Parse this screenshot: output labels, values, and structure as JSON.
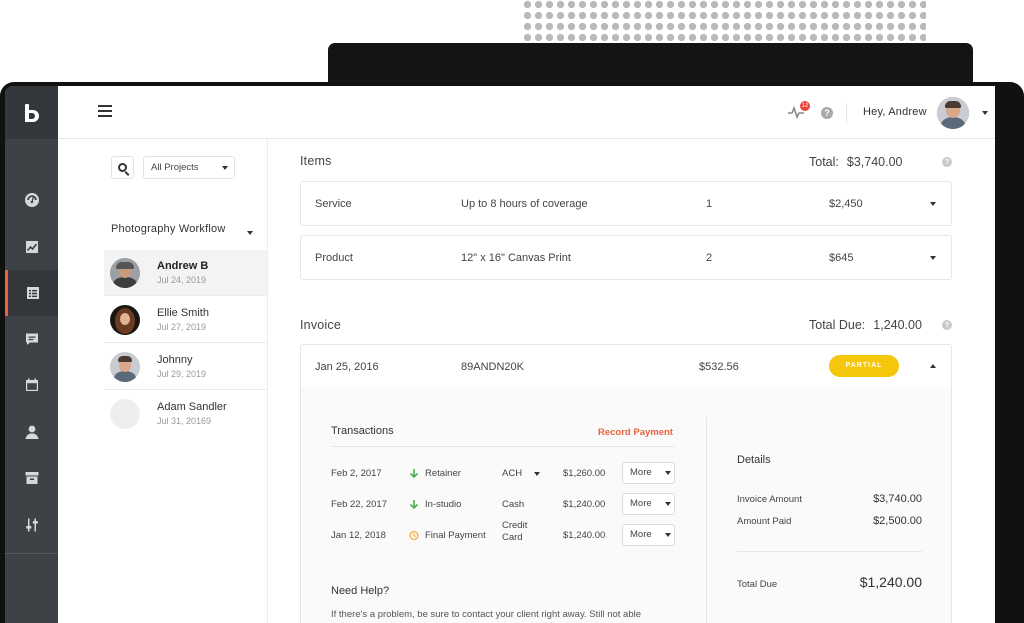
{
  "header": {
    "notification_count": "12",
    "help_glyph": "?",
    "greeting": "Hey, Andrew"
  },
  "sidebar": {
    "items": [
      {
        "icon": "speedometer-icon"
      },
      {
        "icon": "chart-icon"
      },
      {
        "icon": "list-icon",
        "active": true
      },
      {
        "icon": "chat-icon"
      },
      {
        "icon": "calendar-icon"
      },
      {
        "icon": "user-icon"
      },
      {
        "icon": "archive-icon"
      },
      {
        "icon": "sliders-icon"
      }
    ]
  },
  "filters": {
    "project_select": "All Projects"
  },
  "workflow": {
    "title": "Photography Workflow",
    "clients": [
      {
        "name": "Andrew B",
        "date": "Jul 24, 2019",
        "selected": true
      },
      {
        "name": "Ellie Smith",
        "date": "Jul 27, 2019"
      },
      {
        "name": "Johnny",
        "date": "Jul 29, 2019"
      },
      {
        "name": "Adam Sandler",
        "date": "Jul 31, 20169"
      }
    ]
  },
  "items": {
    "title": "Items",
    "total_label": "Total:",
    "total_value": "$3,740.00",
    "rows": [
      {
        "type": "Service",
        "description": "Up to 8 hours of coverage",
        "qty": "1",
        "price": "$2,450"
      },
      {
        "type": "Product",
        "description": "12\" x 16\" Canvas Print",
        "qty": "2",
        "price": "$645"
      }
    ]
  },
  "invoice": {
    "title": "Invoice",
    "total_due_label": "Total Due:",
    "total_due_value": "1,240.00",
    "date": "Jan 25, 2016",
    "number": "89ANDN20K",
    "amount": "$532.56",
    "status": "PARTIAL",
    "transactions": {
      "title": "Transactions",
      "record_payment": "Record Payment",
      "rows": [
        {
          "date": "Feb 2, 2017",
          "type": "Retainer",
          "method": "ACH",
          "amount": "$1,260.00",
          "action": "More",
          "icon": "arrow-down-icon"
        },
        {
          "date": "Feb 22, 2017",
          "type": "In-studio",
          "method": "Cash",
          "amount": "$1,240.00",
          "action": "More",
          "icon": "arrow-down-icon"
        },
        {
          "date": "Jan 12, 2018",
          "type": "Final Payment",
          "method_line1": "Credit",
          "method_line2": "Card",
          "amount": "$1,240.00",
          "action": "More",
          "icon": "clock-icon"
        }
      ]
    },
    "details": {
      "title": "Details",
      "invoice_amount_label": "Invoice Amount",
      "invoice_amount_value": "$3,740.00",
      "amount_paid_label": "Amount Paid",
      "amount_paid_value": "$2,500.00",
      "total_due_label": "Total Due",
      "total_due_value": "$1,240.00"
    },
    "help": {
      "title": "Need Help?",
      "text": "If there's a problem, be sure to contact your client right away. Still not able"
    }
  },
  "colors": {
    "accent": "#e8643c",
    "status_partial": "#f4c60c",
    "sidebar": "#3e4247",
    "incoming": "#4caf50",
    "pending": "#f5a623"
  }
}
